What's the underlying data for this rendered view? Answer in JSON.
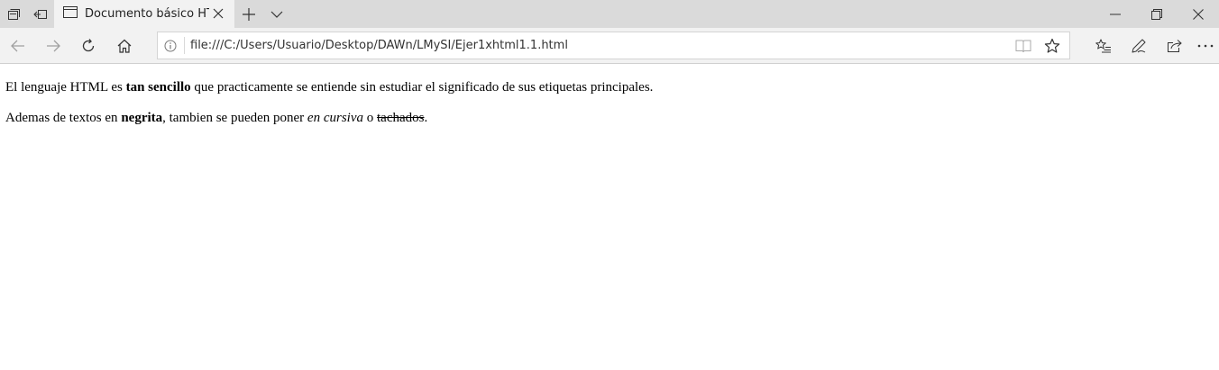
{
  "tabs": [
    {
      "title": "Documento básico HTML"
    }
  ],
  "address_bar": {
    "url": "file:///C:/Users/Usuario/Desktop/DAWn/LMySI/Ejer1xhtml1.1.html"
  },
  "page": {
    "paragraph1": {
      "part1": "El lenguaje HTML es ",
      "bold": "tan sencillo",
      "part2": " que practicamente se entiende sin estudiar el significado de sus etiquetas principales."
    },
    "paragraph2": {
      "part1": "Ademas de textos en ",
      "bold": "negrita",
      "part2": ", tambien se pueden poner ",
      "italic": "en cursiva",
      "part3": " o ",
      "strike": "tachados",
      "part4": "."
    }
  },
  "icons": {
    "tab_preview": "tab-preview-icon",
    "set_aside": "set-aside-tabs-icon",
    "page": "page-icon",
    "close_tab": "close-icon",
    "new_tab": "plus-icon",
    "tab_menu": "chevron-down-icon",
    "back": "back-arrow-icon",
    "forward": "forward-arrow-icon",
    "refresh": "refresh-icon",
    "home": "home-icon",
    "info": "info-icon",
    "reading_view": "reading-view-icon",
    "favorite": "star-icon",
    "favorites_hub": "favorites-list-icon",
    "web_note": "pen-icon",
    "share": "share-icon",
    "more": "more-icon",
    "minimize": "minimize-icon",
    "restore": "restore-icon",
    "close_window": "close-icon"
  }
}
